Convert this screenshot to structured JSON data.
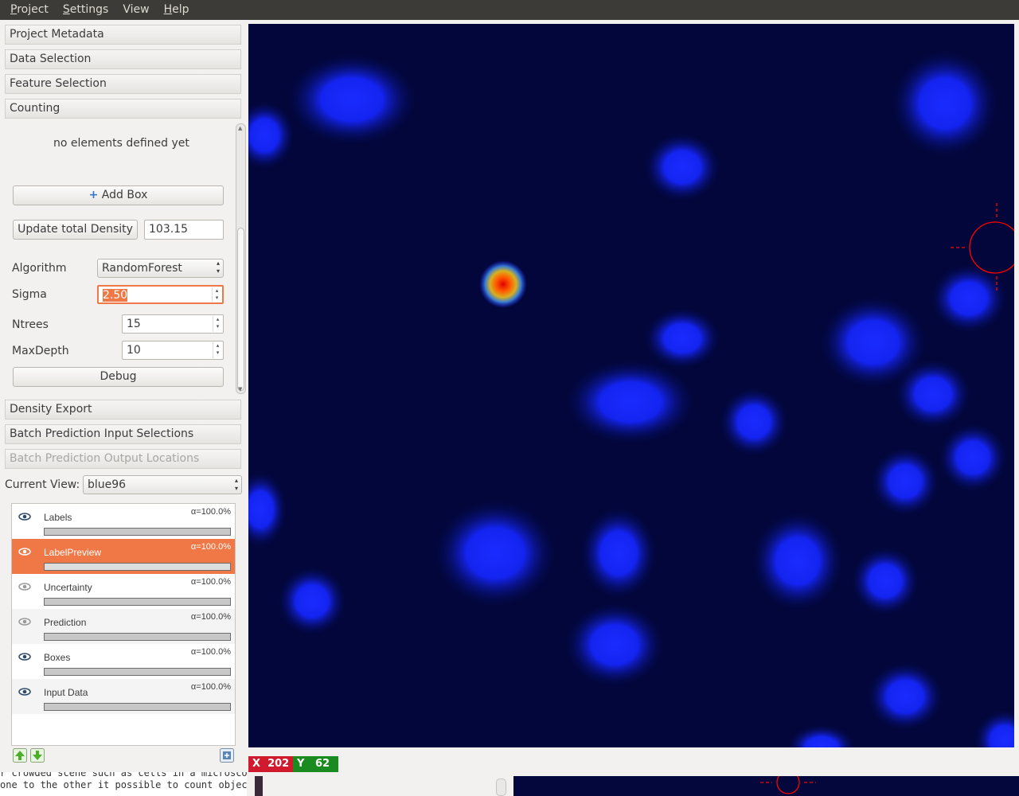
{
  "menubar": {
    "items": [
      {
        "label": "Project",
        "mnemonic": "P",
        "rest": "roject"
      },
      {
        "label": "Settings",
        "mnemonic": "S",
        "rest": "ettings"
      },
      {
        "label": "View",
        "mnemonic": "",
        "rest": "View"
      },
      {
        "label": "Help",
        "mnemonic": "H",
        "rest": "elp"
      }
    ]
  },
  "drawers": {
    "project_metadata": "Project Metadata",
    "data_selection": "Data Selection",
    "feature_selection": "Feature Selection",
    "counting": "Counting",
    "density_export": "Density Export",
    "batch_input": "Batch Prediction Input Selections",
    "batch_output": "Batch Prediction Output Locations"
  },
  "counting": {
    "empty_text": "no elements defined yet",
    "add_box_label": "Add Box",
    "update_density_label": "Update total Density",
    "total_density": "103.15",
    "algorithm_label": "Algorithm",
    "algorithm_value": "RandomForest",
    "sigma_label": "Sigma",
    "sigma_value": "2.50",
    "ntrees_label": "Ntrees",
    "ntrees_value": "15",
    "maxdepth_label": "MaxDepth",
    "maxdepth_value": "10",
    "debug_label": "Debug"
  },
  "current_view": {
    "label": "Current View:",
    "value": "blue96"
  },
  "layers": [
    {
      "name": "Labels",
      "alpha": "α=100.0%",
      "visible": true,
      "selected": false
    },
    {
      "name": "LabelPreview",
      "alpha": "α=100.0%",
      "visible": true,
      "selected": true
    },
    {
      "name": "Uncertainty",
      "alpha": "α=100.0%",
      "visible": false,
      "selected": false
    },
    {
      "name": "Prediction",
      "alpha": "α=100.0%",
      "visible": false,
      "selected": false
    },
    {
      "name": "Boxes",
      "alpha": "α=100.0%",
      "visible": true,
      "selected": false
    },
    {
      "name": "Input Data",
      "alpha": "α=100.0%",
      "visible": true,
      "selected": false
    }
  ],
  "coords": {
    "x_label": "X",
    "x_value": "202",
    "y_label": "Y",
    "y_value": "62"
  },
  "console": {
    "line1": "r crowded scene such as cells in a microsco",
    "line2": "one to the other it possible to count objec"
  },
  "colors": {
    "selected_layer": "#f07746",
    "viewer_bg": "#02063a",
    "cell_blue": "#1a2bff",
    "x_badge": "#d11a2e",
    "y_badge": "#1a8b1e",
    "crosshair": "#ff0000"
  }
}
